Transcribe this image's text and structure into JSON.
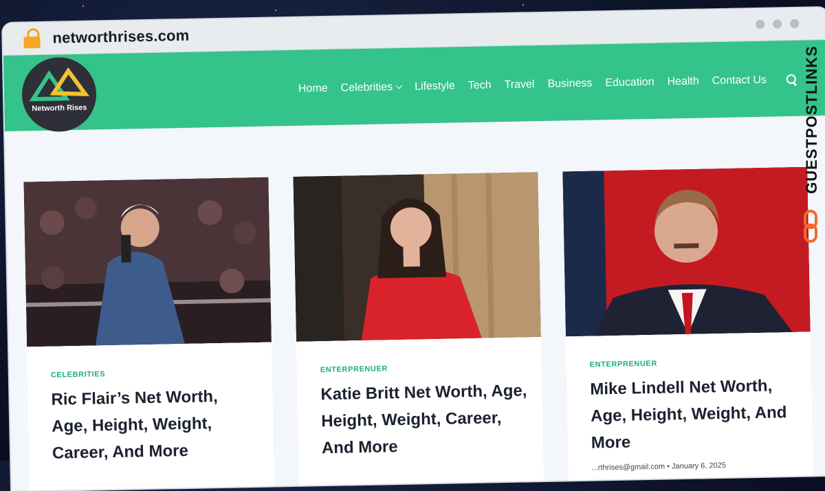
{
  "browser": {
    "url": "networthrises.com"
  },
  "site": {
    "logo_text": "Networth Rises",
    "nav": [
      "Home",
      "Celebrities",
      "Lifestyle",
      "Tech",
      "Travel",
      "Business",
      "Education",
      "Health",
      "Contact Us"
    ],
    "accent_color": "#34c38a"
  },
  "cards": [
    {
      "category": "CELEBRITIES",
      "title": "Ric Flair’s Net Worth, Age, Height, Weight, Career, And More",
      "meta": ""
    },
    {
      "category": "ENTERPRENUER",
      "title": "Katie Britt Net Worth, Age, Height, Weight, Career, And More",
      "meta": ""
    },
    {
      "category": "ENTERPRENUER",
      "title": "Mike Lindell Net Worth, Age, Height, Weight, And More",
      "meta": "...rthrises@gmail.com • January 6, 2025"
    }
  ],
  "watermark": "GUESTPOSTLINKS"
}
